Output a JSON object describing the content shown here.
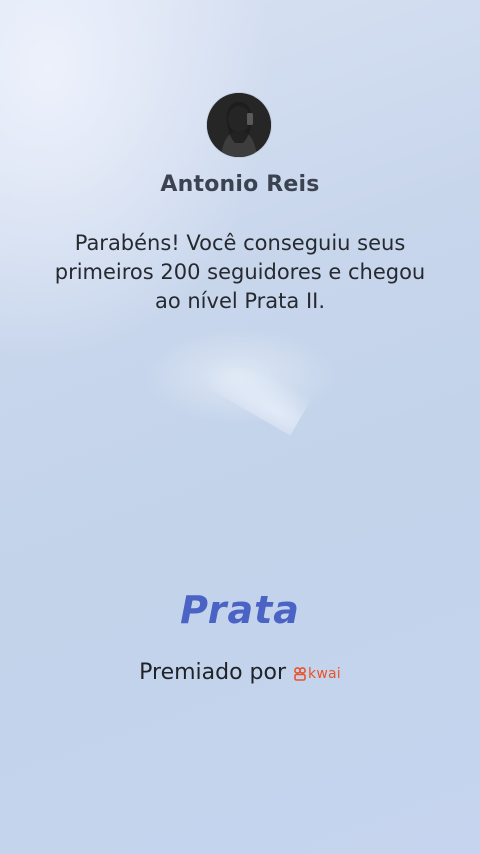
{
  "profile": {
    "name": "Antonio Reis"
  },
  "message": {
    "text": "Parabéns! Você conseguiu seus primeiros 200 seguidores e chegou ao nível Prata II."
  },
  "level": {
    "title": "Prata"
  },
  "awarded": {
    "label": "Premiado por",
    "brand": "kwai"
  },
  "colors": {
    "level_title": "#4a63c4",
    "brand": "#e9532a",
    "text_primary": "#262a30",
    "name": "#3b4350"
  },
  "icons": {
    "avatar": "user-avatar-photo",
    "brand_logo": "kwai-logo-icon"
  }
}
